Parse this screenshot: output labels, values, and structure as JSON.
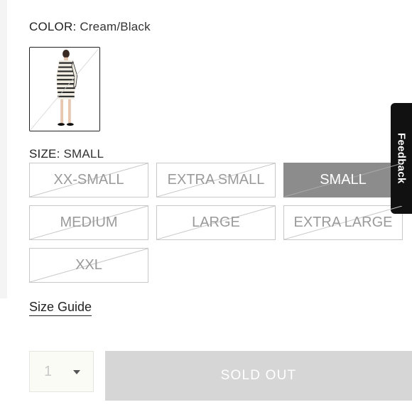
{
  "color": {
    "label": "COLOR:",
    "value": "Cream/Black"
  },
  "swatch": {
    "alt": "Cream/Black striped dress"
  },
  "size": {
    "label": "SIZE:",
    "value": "SMALL",
    "options": [
      {
        "label": "XX-SMALL",
        "selected": false,
        "unavailable": true
      },
      {
        "label": "EXTRA SMALL",
        "selected": false,
        "unavailable": true
      },
      {
        "label": "SMALL",
        "selected": true,
        "unavailable": true
      },
      {
        "label": "MEDIUM",
        "selected": false,
        "unavailable": true
      },
      {
        "label": "LARGE",
        "selected": false,
        "unavailable": true
      },
      {
        "label": "EXTRA LARGE",
        "selected": false,
        "unavailable": true
      },
      {
        "label": "XXL",
        "selected": false,
        "unavailable": true
      }
    ]
  },
  "size_guide": "Size Guide",
  "quantity": {
    "value": "1"
  },
  "cta": {
    "label": "SOLD OUT"
  },
  "feedback": {
    "label": "Feedback"
  }
}
